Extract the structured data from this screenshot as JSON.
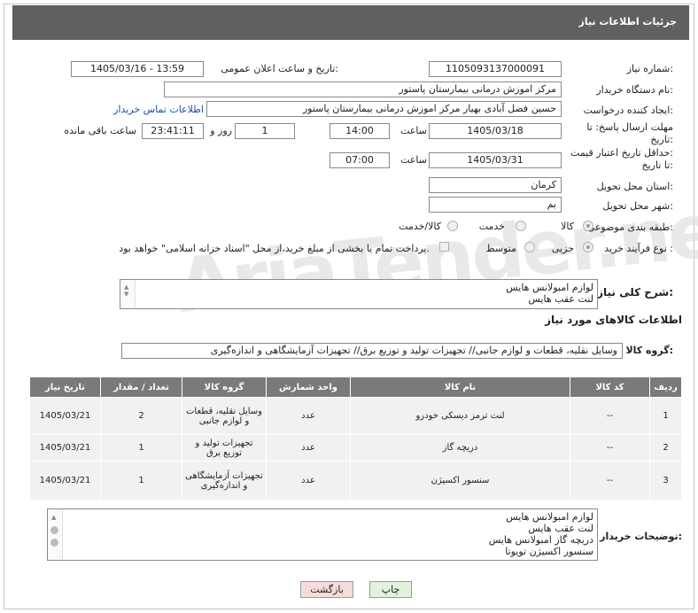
{
  "header": {
    "title": "جزئیات اطلاعات نیاز"
  },
  "fields": {
    "need_number_label": "شماره نیاز:",
    "need_number": "1105093137000091",
    "announce_label": "تاریخ و ساعت اعلان عمومی:",
    "announce_value": "1405/03/16 - 13:59",
    "buyer_org_label": "نام دستگاه خریدار:",
    "buyer_org": "مرکز اموزش درمانی بیمارستان پاستور",
    "requester_label": "ایجاد کننده درخواست:",
    "requester": "حسین فضل آبادی بهیار مرکز اموزش درمانی بیمارستان پاستور",
    "contact_link": "اطلاعات تماس خریدار",
    "deadline_label_1": "مهلت ارسال پاسخ: تا",
    "deadline_label_2": "تاریخ:",
    "deadline_date": "1405/03/18",
    "time_label": "ساعت",
    "deadline_time": "14:00",
    "days_value": "1",
    "days_label": "روز و",
    "remaining_time": "23:41:11",
    "remaining_label": "ساعت باقی مانده",
    "validity_label_1": "حداقل تاریخ اعتبار قیمت:",
    "validity_label_2": "تا تاریخ:",
    "validity_date": "1405/03/31",
    "validity_time_label": "ساعت",
    "validity_time": "07:00",
    "province_label": "استان محل تحویل:",
    "province": "کرمان",
    "city_label": "شهر محل تحویل:",
    "city": "بم",
    "category_label": "طبقه بندی موضوعی:",
    "category_options": [
      "کالا",
      "خدمت",
      "کالا/خدمت"
    ],
    "process_label": "نوع فرآیند خرید :",
    "process_options": [
      "جزیی",
      "متوسط"
    ],
    "payment_note": "پرداخت تمام یا بخشی از مبلغ خرید،از محل \"اسناد خزانه اسلامی\" خواهد بود."
  },
  "description": {
    "label": "شرح کلی نیاز:",
    "lines": [
      "لوازم امبولانس هایس",
      "لنت عقب هایس"
    ]
  },
  "goods_section_title": "اطلاعات کالاهای مورد نیاز",
  "goods_group": {
    "label": "گروه کالا:",
    "value": "وسایل نقلیه، قطعات و لوازم جانبی// تجهیزات تولید و توزیع برق// تجهیزات آزمایشگاهی و اندازه‌گیری"
  },
  "table": {
    "headers": [
      "ردیف",
      "کد کالا",
      "نام کالا",
      "واحد شمارش",
      "گروه کالا",
      "تعداد / مقدار",
      "تاریخ نیاز"
    ],
    "rows": [
      {
        "row": "1",
        "code": "--",
        "name": "لنت ترمز دیسکی خودرو",
        "unit": "عدد",
        "group": "وسایل نقلیه، قطعات و لوازم جانبی",
        "qty": "2",
        "date": "1405/03/21"
      },
      {
        "row": "2",
        "code": "--",
        "name": "دریچه گاز",
        "unit": "عدد",
        "group": "تجهیزات تولید و توزیع برق",
        "qty": "1",
        "date": "1405/03/21"
      },
      {
        "row": "3",
        "code": "--",
        "name": "سنسور اکسیژن",
        "unit": "عدد",
        "group": "تجهیزات آزمایشگاهی و اندازه‌گیری",
        "qty": "1",
        "date": "1405/03/21"
      }
    ]
  },
  "buyer_notes": {
    "label": "توضیحات خریدار:",
    "lines": [
      "لوازم امبولانس هایس",
      "لنت عقب هایس",
      "دریچه گاز امبولانس هایس",
      "سنسور اکسیژن تویوتا"
    ]
  },
  "buttons": {
    "print": "چاپ",
    "back": "بازگشت"
  },
  "watermark": "AriaTender.neT"
}
